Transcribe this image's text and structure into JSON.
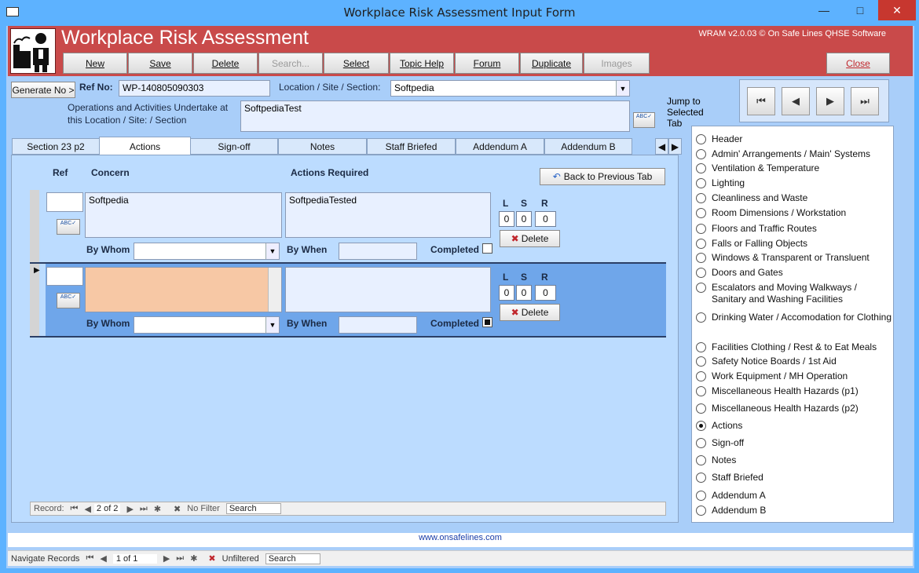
{
  "window": {
    "title": "Workplace Risk Assessment Input Form"
  },
  "app": {
    "title": "Workplace Risk Assessment",
    "version": "WRAM v2.0.03 © On Safe Lines QHSE Software"
  },
  "toolbar": {
    "new": "New",
    "save": "Save",
    "delete": "Delete",
    "search": "Search...",
    "select": "Select",
    "topic_help": "Topic Help",
    "forum": "Forum",
    "duplicate": "Duplicate",
    "images": "Images",
    "close": "Close"
  },
  "form": {
    "generate_no": "Generate No >",
    "ref_label": "Ref No:",
    "ref_value": "WP-140805090303",
    "location_label": "Location / Site / Section:",
    "location_value": "Softpedia",
    "ops_label": "Operations and Activities Undertake at this Location / Site: / Section",
    "ops_value": "SoftpediaTest",
    "jump_label": "Jump to Selected Tab"
  },
  "tabs": [
    "Section 23 p2",
    "Actions",
    "Sign-off",
    "Notes",
    "Staff Briefed",
    "Addendum A",
    "Addendum B"
  ],
  "actions": {
    "col_ref": "Ref",
    "col_concern": "Concern",
    "col_actions": "Actions Required",
    "back_button": "Back to Previous Tab",
    "by_whom": "By Whom",
    "by_when": "By When",
    "completed": "Completed",
    "l": "L",
    "s": "S",
    "r": "R",
    "delete": "Delete",
    "rows": [
      {
        "concern": "Softpedia",
        "actions": "SoftpediaTested",
        "l": "0",
        "s": "0",
        "r": "0"
      },
      {
        "concern": "",
        "actions": "",
        "l": "0",
        "s": "0",
        "r": "0"
      }
    ]
  },
  "subnav": {
    "record": "Record:",
    "pos": "2 of 2",
    "filter": "No Filter",
    "search": "Search"
  },
  "sidebar": [
    "Header",
    "Admin' Arrangements / Main' Systems",
    "Ventilation & Temperature",
    "Lighting",
    "Cleanliness and Waste",
    "Room Dimensions / Workstation",
    "Floors and Traffic Routes",
    "Falls or Falling Objects",
    "Windows & Transparent or Transluent",
    "Doors and Gates",
    "Escalators and Moving Walkways / Sanitary and Washing Facilities",
    "Drinking Water / Accomodation for Clothing",
    "Facilities Clothing / Rest & to Eat Meals",
    "Safety Notice Boards / 1st Aid",
    "Work Equipment / MH Operation",
    "Miscellaneous Health Hazards (p1)",
    "Miscellaneous Health Hazards (p2)",
    "Actions",
    "Sign-off",
    "Notes",
    "Staff Briefed",
    "Addendum A",
    "Addendum B"
  ],
  "selected_option": "Actions",
  "footer": {
    "url": "www.onsafelines.com"
  },
  "statusbar": {
    "navigate": "Navigate Records",
    "pos": "1 of 1",
    "filter": "Unfiltered",
    "search": "Search"
  }
}
